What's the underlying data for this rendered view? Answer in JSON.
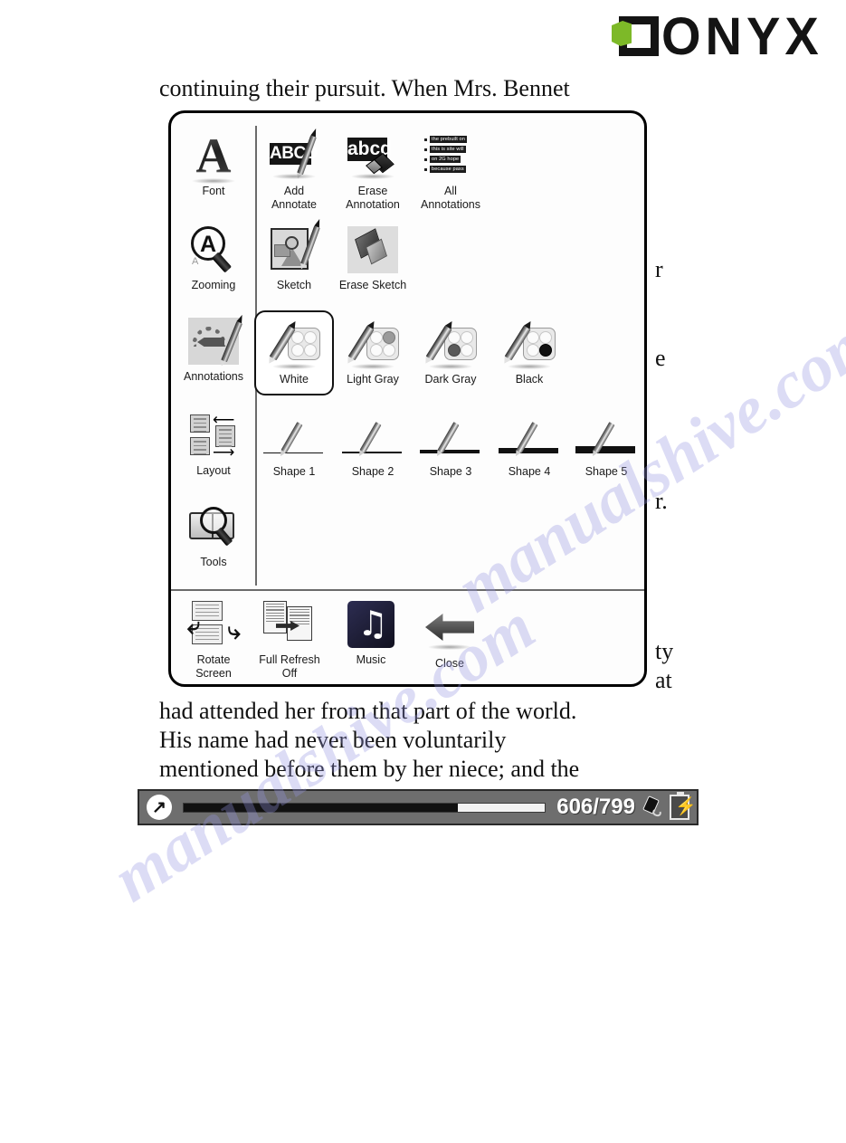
{
  "brand": {
    "name": "ONYX",
    "logo_icon": "onyx-logo-icon",
    "accent_color": "#7db928",
    "mark_color": "#141414"
  },
  "book": {
    "visible_lines_above": [
      "continuing their pursuit. When Mrs. Bennet"
    ],
    "visible_lines_below": [
      "had attended her from that part of the world.",
      "His name had never been voluntarily",
      "mentioned before them by her niece; and the"
    ],
    "right_edge_fragments": [
      "r",
      "e",
      "r.",
      "ty",
      "at"
    ]
  },
  "watermark": {
    "text": "manualshive.com",
    "color": "#9696e1"
  },
  "menu": {
    "selected_item": "White",
    "sidebar": [
      {
        "label": "Font",
        "icon": "font-icon"
      },
      {
        "label": "Zooming",
        "icon": "zooming-icon"
      },
      {
        "label": "Annotations",
        "icon": "annotations-icon"
      },
      {
        "label": "Layout",
        "icon": "layout-icon"
      },
      {
        "label": "Tools",
        "icon": "tools-icon"
      }
    ],
    "annotation_row": [
      {
        "label": "Add\nAnnotate",
        "line1": "Add",
        "line2": "Annotate",
        "icon": "add-annotate-icon",
        "box_text": "ABCD"
      },
      {
        "label": "Erase\nAnnotation",
        "line1": "Erase",
        "line2": "Annotation",
        "icon": "erase-annotation-icon",
        "box_text": "abcd"
      },
      {
        "label": "All\nAnnotations",
        "line1": "All",
        "line2": "Annotations",
        "icon": "all-annotations-icon",
        "strips": [
          "the prebuilt on",
          "this is site will",
          "on  2G hope",
          "because pass"
        ]
      }
    ],
    "sketch_row": [
      {
        "label": "Sketch",
        "icon": "sketch-icon"
      },
      {
        "label": "Erase Sketch",
        "icon": "erase-sketch-icon"
      }
    ],
    "color_row": [
      {
        "label": "White",
        "icon": "pen-white-icon",
        "swatch": "#ffffff",
        "selected": true
      },
      {
        "label": "Light Gray",
        "icon": "pen-light-gray-icon",
        "swatch": "#9a9a9a",
        "selected": false
      },
      {
        "label": "Dark Gray",
        "icon": "pen-dark-gray-icon",
        "swatch": "#5a5a5a",
        "selected": false
      },
      {
        "label": "Black",
        "icon": "pen-black-icon",
        "swatch": "#111111",
        "selected": false
      }
    ],
    "shape_row": [
      {
        "label": "Shape 1",
        "icon": "shape-1-icon",
        "thickness": 1
      },
      {
        "label": "Shape 2",
        "icon": "shape-2-icon",
        "thickness": 2
      },
      {
        "label": "Shape 3",
        "icon": "shape-3-icon",
        "thickness": 4
      },
      {
        "label": "Shape 4",
        "icon": "shape-4-icon",
        "thickness": 6
      },
      {
        "label": "Shape 5",
        "icon": "shape-5-icon",
        "thickness": 8
      }
    ],
    "bottom_row": [
      {
        "label": "Rotate\nScreen",
        "line1": "Rotate",
        "line2": "Screen",
        "icon": "rotate-screen-icon"
      },
      {
        "label": "Full Refresh\nOff",
        "line1": "Full Refresh",
        "line2": "Off",
        "icon": "full-refresh-off-icon"
      },
      {
        "label": "Music",
        "line1": "Music",
        "line2": "",
        "icon": "music-icon"
      },
      {
        "label": "Close",
        "line1": "Close",
        "line2": "",
        "icon": "close-arrow-icon"
      }
    ]
  },
  "statusbar": {
    "home_icon": "home-arrow-icon",
    "page_current": 606,
    "page_total": 799,
    "page_text": "606/799",
    "progress_percent": 76,
    "stylus_icon": "stylus-icon",
    "battery_icon": "battery-charging-icon"
  }
}
